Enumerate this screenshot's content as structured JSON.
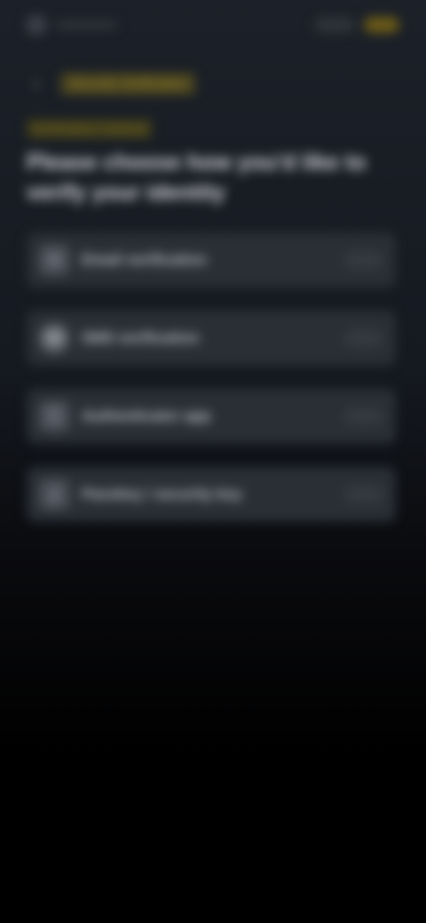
{
  "status_bar": {
    "left_icon": "app-logo-icon",
    "right_badge": ""
  },
  "header": {
    "back_icon": "chevron-left-icon",
    "breadcrumb": "Security Verification"
  },
  "content": {
    "eyebrow": "Verification method",
    "title": "Please choose how you'd like to verify your identity",
    "options": [
      {
        "icon": "email-icon",
        "label": "Email verification"
      },
      {
        "icon": "phone-icon",
        "label": "SMS verification"
      },
      {
        "icon": "authenticator-icon",
        "label": "Authenticator app"
      },
      {
        "icon": "passkey-icon",
        "label": "Passkey / security key"
      }
    ]
  },
  "colors": {
    "accent": "#b8972a",
    "card_bg": "#2a2f36",
    "page_bg_top": "#1c2129",
    "page_bg_bottom": "#000000"
  }
}
